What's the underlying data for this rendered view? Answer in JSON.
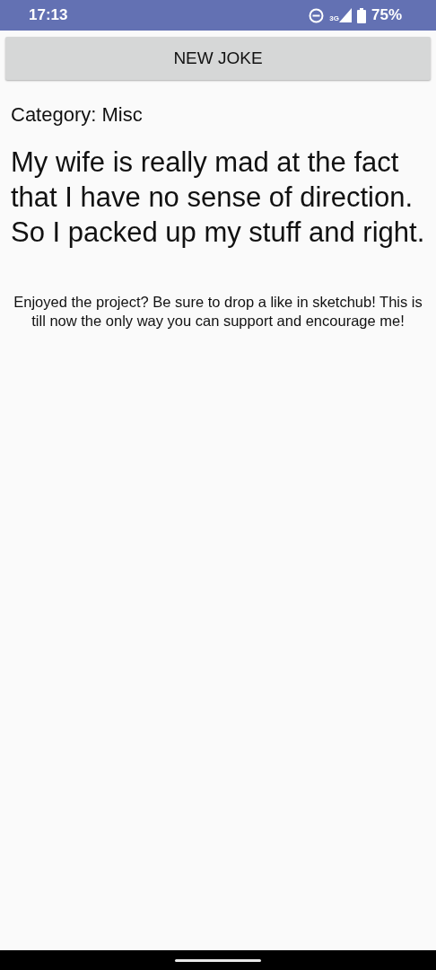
{
  "status_bar": {
    "time": "17:13",
    "network": "3G",
    "battery": "75%"
  },
  "button": {
    "label": "NEW JOKE"
  },
  "category": "Category: Misc",
  "joke": [
    "My wife is really mad at the fact that I have no sense of direction.",
    "So I packed up my stuff and right."
  ],
  "footer": "Enjoyed the project? Be sure to drop a like in sketchub! This is till now the only way you can support and encourage me!"
}
